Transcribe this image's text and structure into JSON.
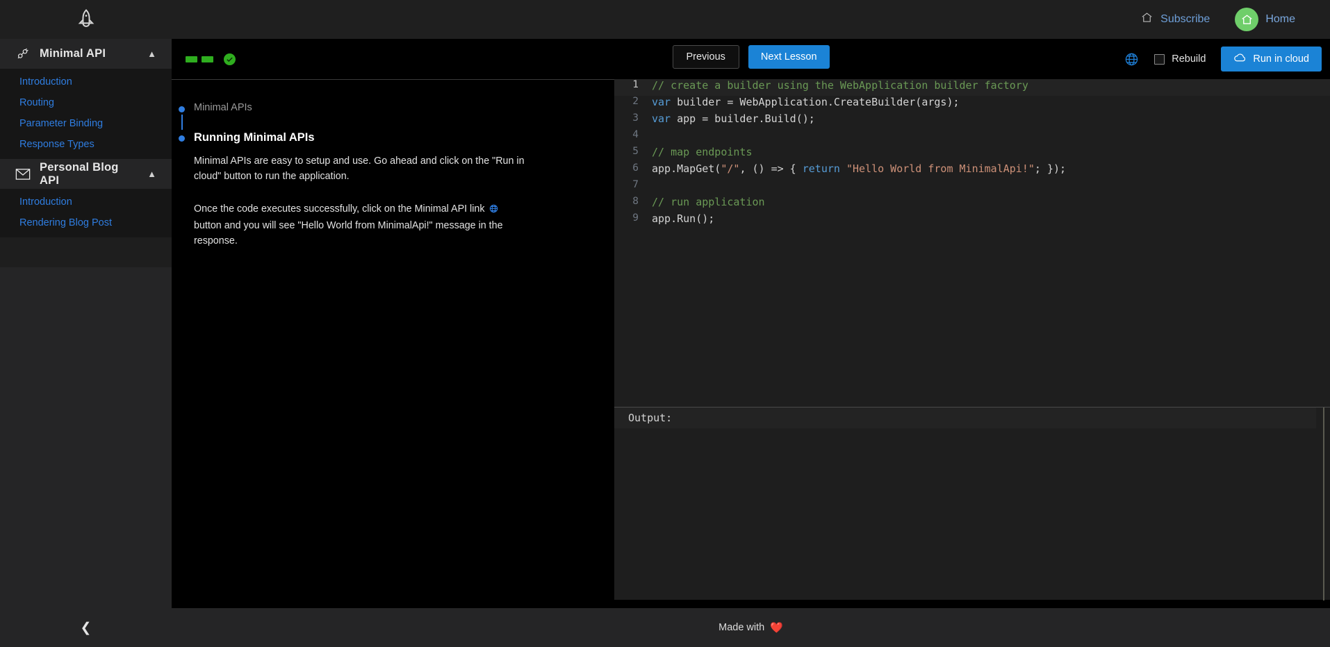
{
  "header": {
    "logo_icon": "rocket-icon",
    "subscribe_label": "Subscribe",
    "subscribe_icon": "home-icon",
    "home_label": "Home",
    "home_icon": "home-icon",
    "accent_green": "#6fce6a",
    "link_blue": "#6e9fd8"
  },
  "sidebar": {
    "groups": [
      {
        "title": "Minimal API",
        "icon": "plug-icon",
        "expanded": true,
        "chevron": "chevron-up-icon",
        "items": [
          {
            "label": "Introduction"
          },
          {
            "label": "Routing"
          },
          {
            "label": "Parameter Binding"
          },
          {
            "label": "Response Types"
          }
        ]
      },
      {
        "title": "Personal Blog API",
        "icon": "envelope-icon",
        "expanded": true,
        "chevron": "chevron-up-icon",
        "items": [
          {
            "label": "Introduction"
          },
          {
            "label": "Rendering Blog Post"
          }
        ]
      }
    ],
    "collapse_icon": "chevron-left-icon",
    "link_color": "#2f7de0"
  },
  "toolbar": {
    "progress_chips": 2,
    "status_icon": "check-circle-icon",
    "status_color": "#2fae1f",
    "previous_label": "Previous",
    "next_label": "Next Lesson",
    "globe_icon": "globe-icon",
    "rebuild_label": "Rebuild",
    "rebuild_checked": false,
    "run_label": "Run in cloud",
    "run_icon": "cloud-icon",
    "primary_blue": "#1b83d6"
  },
  "lesson": {
    "breadcrumb": "Minimal APIs",
    "title": "Running Minimal APIs",
    "paragraph_1": "Minimal APIs are easy to setup and use. Go ahead and click on the \"Run in cloud\" button to run the application.",
    "paragraph_2_before": "Once the code executes successfully, click on the Minimal API link",
    "paragraph_2_icon": "globe-icon",
    "paragraph_2_after": "button and you will see \"Hello World from MinimalApi!\" message in the response."
  },
  "editor": {
    "active_line": 1,
    "lines": [
      {
        "n": "1",
        "tokens": [
          {
            "t": "// create a builder using the WebApplication builder factory",
            "c": "cmt"
          }
        ]
      },
      {
        "n": "2",
        "tokens": [
          {
            "t": "var",
            "c": "kw"
          },
          {
            "t": " builder = WebApplication.CreateBuilder(args);",
            "c": "pln"
          }
        ]
      },
      {
        "n": "3",
        "tokens": [
          {
            "t": "var",
            "c": "kw"
          },
          {
            "t": " app = builder.Build();",
            "c": "pln"
          }
        ]
      },
      {
        "n": "4",
        "tokens": [
          {
            "t": "",
            "c": "pln"
          }
        ]
      },
      {
        "n": "5",
        "tokens": [
          {
            "t": "// map endpoints",
            "c": "cmt"
          }
        ]
      },
      {
        "n": "6",
        "tokens": [
          {
            "t": "app.MapGet(",
            "c": "pln"
          },
          {
            "t": "\"/\"",
            "c": "str"
          },
          {
            "t": ", () => { ",
            "c": "pln"
          },
          {
            "t": "return",
            "c": "kw"
          },
          {
            "t": " ",
            "c": "pln"
          },
          {
            "t": "\"Hello World from MinimalApi!\"",
            "c": "str"
          },
          {
            "t": "; });",
            "c": "pln"
          }
        ]
      },
      {
        "n": "7",
        "tokens": [
          {
            "t": "",
            "c": "pln"
          }
        ]
      },
      {
        "n": "8",
        "tokens": [
          {
            "t": "// run application",
            "c": "cmt"
          }
        ]
      },
      {
        "n": "9",
        "tokens": [
          {
            "t": "app.Run();",
            "c": "pln"
          }
        ]
      }
    ]
  },
  "output": {
    "label": "Output:",
    "content": ""
  },
  "footer": {
    "made_with": "Made with",
    "heart": "❤️"
  }
}
